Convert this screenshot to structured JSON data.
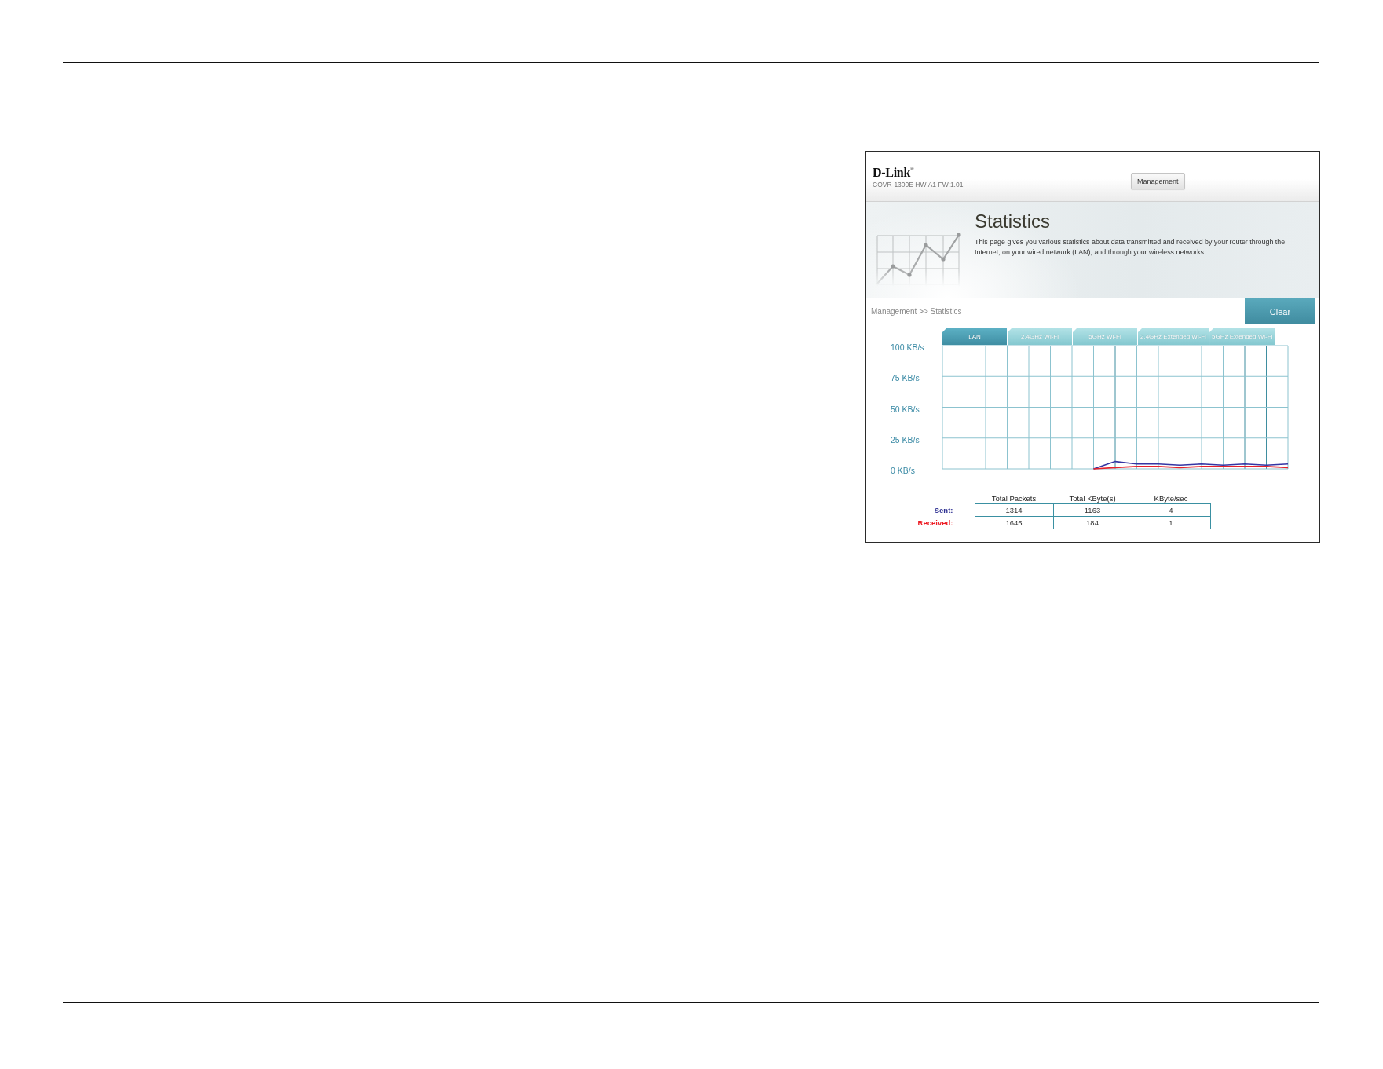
{
  "header": {
    "logo": "D-Link$^{®}$",
    "model": "COVR-1300E HW:A1 FW:1.01",
    "menu": [
      "Management"
    ]
  },
  "banner": {
    "title": "Statistics",
    "description": "This page gives you various statistics about data transmitted and received by your router through the Internet, on your wired network (LAN), and through your wireless networks."
  },
  "breadcrumb": "Management >> Statistics",
  "clear_button": "Clear",
  "tabs": [
    {
      "label": "LAN",
      "selected": true
    },
    {
      "label": "2.4GHz Wi-Fi",
      "selected": false
    },
    {
      "label": "5GHz Wi-Fi",
      "selected": false
    },
    {
      "label": "2.4GHz Extended Wi-Fi",
      "selected": false
    },
    {
      "label": "5GHz Extended Wi-Fi",
      "selected": false
    }
  ],
  "chart": {
    "chart_data": {
      "type": "line",
      "grid": true,
      "ylim": [
        0,
        100
      ],
      "yticks": [
        {
          "value": 100,
          "label": "100 KB/s"
        },
        {
          "value": 75,
          "label": "75 KB/s"
        },
        {
          "value": 50,
          "label": "50 KB/s"
        },
        {
          "value": 25,
          "label": "25 KB/s"
        },
        {
          "value": 0,
          "label": "0 KB/s"
        }
      ],
      "series": [
        {
          "color": "#3535a3",
          "values": [
            null,
            null,
            null,
            null,
            null,
            null,
            null,
            0,
            6,
            4,
            4,
            3,
            4,
            3,
            4,
            3,
            4
          ]
        },
        {
          "color": "#e8202a",
          "values": [
            null,
            null,
            null,
            null,
            null,
            null,
            null,
            0,
            1,
            2,
            2,
            1,
            2,
            2,
            2,
            2,
            1
          ]
        }
      ]
    }
  },
  "table": {
    "columns": [
      "Total Packets",
      "Total KByte(s)",
      "KByte/sec"
    ],
    "rows": [
      {
        "label": "Sent:",
        "color": "#2e3192",
        "cells": [
          "1314",
          "1163",
          "4"
        ]
      },
      {
        "label": "Received:",
        "color": "#ed1c24",
        "cells": [
          "1645",
          "184",
          "1"
        ]
      }
    ]
  }
}
